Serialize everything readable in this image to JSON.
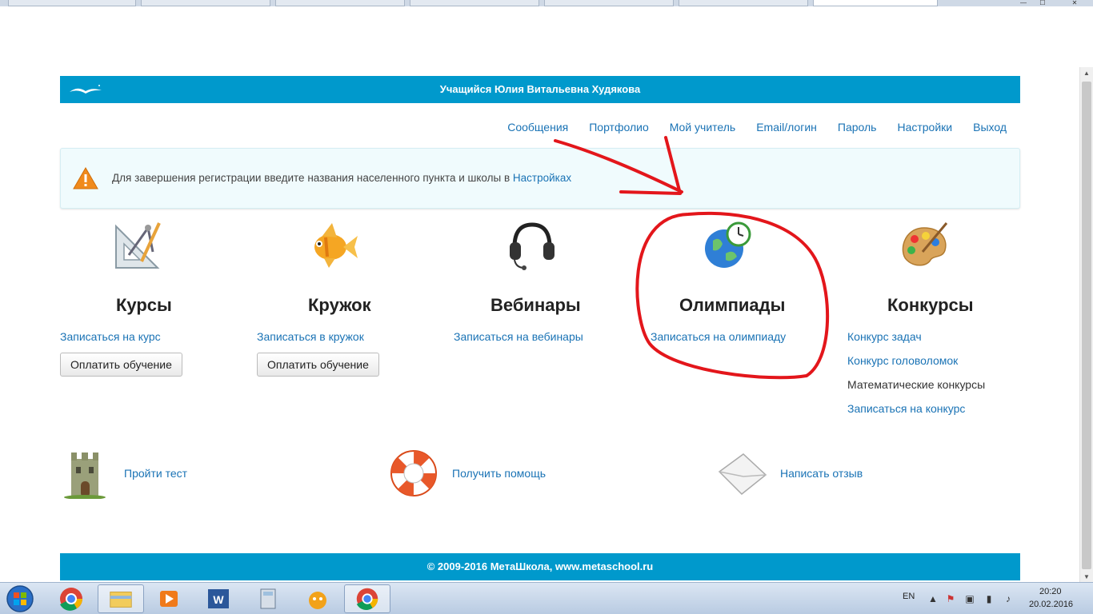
{
  "browser": {
    "window_controls": {
      "minimize": "—",
      "maximize": "☐",
      "close": "✕"
    }
  },
  "header": {
    "title": "Учащийся Юлия Витальевна Худякова",
    "logo_icon": "seagull-logo-icon"
  },
  "topnav": {
    "items": [
      "Сообщения",
      "Портфолио",
      "Мой учитель",
      "Email/логин",
      "Пароль",
      "Настройки",
      "Выход"
    ]
  },
  "alert": {
    "text": "Для завершения регистрации введите названия населенного пункта и школы в ",
    "link": "Настройках",
    "icon": "warning-icon"
  },
  "sections": {
    "courses": {
      "title": "Курсы",
      "link": "Записаться на курс",
      "button": "Оплатить обучение",
      "icon": "drafting-tools-icon"
    },
    "club": {
      "title": "Кружок",
      "link": "Записаться в кружок",
      "button": "Оплатить обучение",
      "icon": "goldfish-icon"
    },
    "webinars": {
      "title": "Вебинары",
      "link": "Записаться на вебинары",
      "icon": "headset-icon"
    },
    "olympiads": {
      "title": "Олимпиады",
      "link": "Записаться на олимпиаду",
      "icon": "globe-clock-icon"
    },
    "contests": {
      "title": "Конкурсы",
      "links": [
        "Конкурс задач",
        "Конкурс головоломок"
      ],
      "plain": "Математические конкурсы",
      "signup": "Записаться на конкурс",
      "icon": "palette-icon"
    }
  },
  "bottom": {
    "test": {
      "label": "Пройти тест",
      "icon": "tower-icon"
    },
    "help": {
      "label": "Получить помощь",
      "icon": "lifebuoy-icon"
    },
    "feedback": {
      "label": "Написать отзыв",
      "icon": "envelope-icon"
    }
  },
  "footer": {
    "text": "© 2009-2016 МетаШкола, www.metaschool.ru"
  },
  "annotations": {
    "arrow_color": "#e3161b",
    "circle_color": "#e3161b"
  },
  "taskbar": {
    "apps": [
      "start-orb-icon",
      "chrome-icon",
      "explorer-icon",
      "media-player-icon",
      "word-icon",
      "calculator-icon",
      "chat-icon",
      "chrome-icon"
    ],
    "lang": "EN",
    "time": "20:20",
    "date": "20.02.2016"
  },
  "colors": {
    "brand": "#0099cc",
    "link": "#1a73b5"
  }
}
